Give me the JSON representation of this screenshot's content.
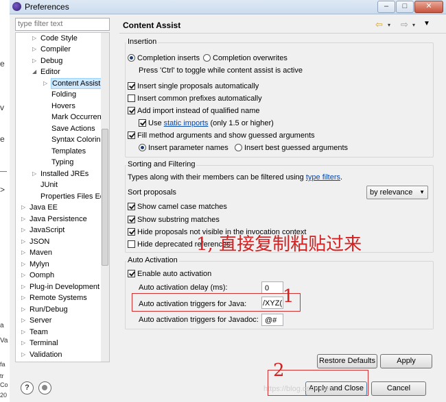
{
  "window": {
    "title": "Preferences",
    "controls": [
      "–",
      "□",
      "✕"
    ]
  },
  "background_window": {
    "fragments": [
      "e",
      "v",
      "l",
      "e",
      "—",
      ">",
      "a",
      "Va",
      "fa",
      "tr",
      "Co",
      "20"
    ]
  },
  "filter": {
    "placeholder": "type filter text"
  },
  "tree": {
    "items": [
      {
        "label": "Code Style",
        "arrow": "▷"
      },
      {
        "label": "Compiler",
        "arrow": "▷"
      },
      {
        "label": "Debug",
        "arrow": "▷"
      },
      {
        "label": "Editor",
        "arrow": "◢"
      },
      {
        "label": "Content Assist",
        "arrow": "▷",
        "selected": true
      },
      {
        "label": "Folding",
        "arrow": ""
      },
      {
        "label": "Hovers",
        "arrow": ""
      },
      {
        "label": "Mark Occurren",
        "arrow": ""
      },
      {
        "label": "Save Actions",
        "arrow": ""
      },
      {
        "label": "Syntax Colorin",
        "arrow": ""
      },
      {
        "label": "Templates",
        "arrow": ""
      },
      {
        "label": "Typing",
        "arrow": ""
      },
      {
        "label": "Installed JREs",
        "arrow": "▷"
      },
      {
        "label": "JUnit",
        "arrow": ""
      },
      {
        "label": "Properties Files Ed",
        "arrow": ""
      },
      {
        "label": "Java EE",
        "arrow": "▷"
      },
      {
        "label": "Java Persistence",
        "arrow": "▷"
      },
      {
        "label": "JavaScript",
        "arrow": "▷"
      },
      {
        "label": "JSON",
        "arrow": "▷"
      },
      {
        "label": "Maven",
        "arrow": "▷"
      },
      {
        "label": "Mylyn",
        "arrow": "▷"
      },
      {
        "label": "Oomph",
        "arrow": "▷"
      },
      {
        "label": "Plug-in Development",
        "arrow": "▷"
      },
      {
        "label": "Remote Systems",
        "arrow": "▷"
      },
      {
        "label": "Run/Debug",
        "arrow": "▷"
      },
      {
        "label": "Server",
        "arrow": "▷"
      },
      {
        "label": "Team",
        "arrow": "▷"
      },
      {
        "label": "Terminal",
        "arrow": "▷"
      },
      {
        "label": "Validation",
        "arrow": "▷"
      }
    ]
  },
  "page": {
    "title": "Content Assist",
    "nav": {
      "back": "⇦",
      "forward": "⇨",
      "dropdown": "▾",
      "menu": "▼"
    }
  },
  "insertion": {
    "title": "Insertion",
    "completion_inserts": "Completion inserts",
    "completion_overwrites": "Completion overwrites",
    "toggle_hint": "Press 'Ctrl' to toggle while content assist is active",
    "insert_single": "Insert single proposals automatically",
    "insert_common": "Insert common prefixes automatically",
    "add_import": "Add import instead of qualified name",
    "use_label": "Use",
    "static_imports_link": "static imports",
    "static_imports_suffix": "(only 1.5 or higher)",
    "fill_method": "Fill method arguments and show guessed arguments",
    "insert_parameter_names": "Insert parameter names",
    "insert_best_guessed": "Insert best guessed arguments"
  },
  "sorting": {
    "title": "Sorting and Filtering",
    "types_text": "Types along with their members can be filtered using",
    "type_filters_link": "type filters",
    "period": ".",
    "sort_proposals_label": "Sort proposals",
    "sort_value": "by relevance",
    "show_camel": "Show camel case matches",
    "show_substring": "Show substring matches",
    "hide_not_visible": "Hide proposals not visible in the invocation context",
    "hide_deprecated": "Hide deprecated references"
  },
  "auto_activation": {
    "title": "Auto Activation",
    "enable": "Enable auto activation",
    "delay_label": "Auto activation delay (ms):",
    "delay_value": "0",
    "java_triggers_label": "Auto activation triggers for Java:",
    "java_triggers_value": "/XYZ(",
    "javadoc_triggers_label": "Auto activation triggers for Javadoc:",
    "javadoc_triggers_value": "@#"
  },
  "buttons": {
    "restore_defaults": "Restore Defaults",
    "apply": "Apply",
    "apply_and_close": "Apply and Close",
    "cancel": "Cancel",
    "help": "?"
  },
  "annotations": {
    "note1": "1, 直接复制粘贴过来",
    "marker1": "1",
    "marker2": "2"
  },
  "watermark": "https://blog.csdn.net/..."
}
